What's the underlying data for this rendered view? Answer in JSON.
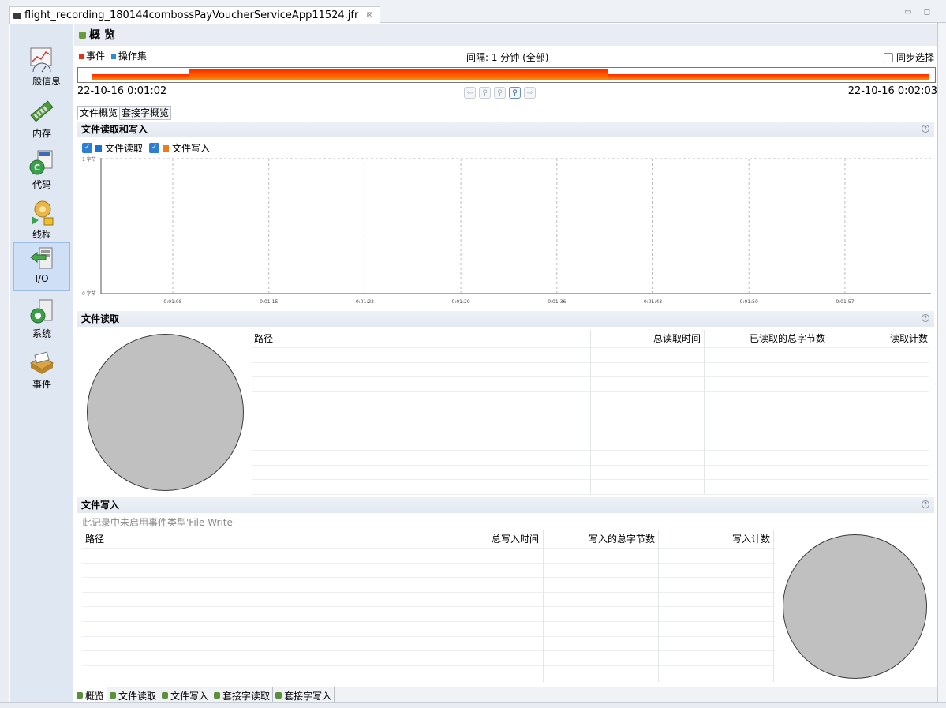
{
  "editor_tab": {
    "title": "flight_recording_180144combossPayVoucherServiceApp11524.jfr",
    "close": "⊠"
  },
  "window_controls": "▭ ◻",
  "leftnav": {
    "items": [
      {
        "label": "一般信息",
        "icon": "general-info-icon"
      },
      {
        "label": "内存",
        "icon": "memory-icon"
      },
      {
        "label": "代码",
        "icon": "code-icon"
      },
      {
        "label": "线程",
        "icon": "threads-icon"
      },
      {
        "label": "I/O",
        "icon": "io-icon",
        "selected": true
      },
      {
        "label": "系统",
        "icon": "system-icon"
      },
      {
        "label": "事件",
        "icon": "events-icon"
      }
    ]
  },
  "page": {
    "title": "概 览",
    "filter": {
      "events": "事件",
      "operation_set": "操作集"
    },
    "interval": "间隔: 1 分钟 (全部)",
    "sync_label": "同步选择",
    "time_start": "22-10-16 0:01:02",
    "time_end": "22-10-16 0:02:03",
    "nav_buttons": [
      "⇦",
      "⚲",
      "⚲",
      "⚲",
      "⇨"
    ]
  },
  "subtabs": [
    "文件概览",
    "套接字概览"
  ],
  "sections": {
    "read_write": {
      "title": "文件读取和写入",
      "help": "?"
    },
    "file_read": {
      "title": "文件读取",
      "help": "?"
    },
    "file_write": {
      "title": "文件写入",
      "help": "?",
      "note": "此记录中未启用事件类型'File Write'"
    }
  },
  "chart_legend": {
    "read": "文件读取",
    "write": "文件写入",
    "check": "✓"
  },
  "chart_data": {
    "type": "line",
    "series": [
      {
        "name": "文件读取",
        "color": "#1f6fd1",
        "values": []
      },
      {
        "name": "文件写入",
        "color": "#f07a1a",
        "values": []
      }
    ],
    "xticks": [
      "0:01:08",
      "0:01:15",
      "0:01:22",
      "0:01:29",
      "0:01:36",
      "0:01:43",
      "0:01:50",
      "0:01:57"
    ],
    "ytop_label": "1 字节",
    "ybottom_label": "0 字节",
    "ylim": [
      0,
      1
    ]
  },
  "read_table": {
    "headers": [
      "路径",
      "总读取时间",
      "已读取的总字节数",
      "读取计数"
    ],
    "rows": []
  },
  "write_table": {
    "headers": [
      "路径",
      "总写入时间",
      "写入的总字节数",
      "写入计数"
    ],
    "rows": []
  },
  "bottom_tabs": [
    "概览",
    "文件读取",
    "文件写入",
    "套接字读取",
    "套接字写入"
  ],
  "colors": {
    "events": "#e0331e",
    "operation_set": "#2b8ad6",
    "accent": "#2d7fd3"
  }
}
